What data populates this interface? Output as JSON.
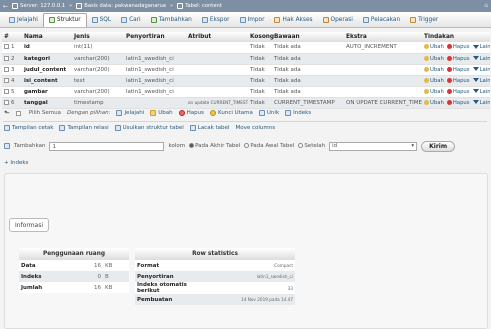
{
  "breadcrumb": {
    "server": "Server: 127.0.0.1",
    "database": "Basis data: pakwanadaganarua",
    "table": "Tabel: content"
  },
  "tabs": [
    {
      "label": "Jelajahi",
      "active": false
    },
    {
      "label": "Struktur",
      "active": true
    },
    {
      "label": "SQL",
      "active": false
    },
    {
      "label": "Cari",
      "active": false
    },
    {
      "label": "Tambahkan",
      "active": false
    },
    {
      "label": "Ekspor",
      "active": false
    },
    {
      "label": "Impor",
      "active": false
    },
    {
      "label": "Hak Akses",
      "active": false
    },
    {
      "label": "Operasi",
      "active": false
    },
    {
      "label": "Pelacakan",
      "active": false
    },
    {
      "label": "Trigger",
      "active": false
    }
  ],
  "columns_table": {
    "headers": [
      "#",
      "Nama",
      "Jenis",
      "Penyortiran",
      "Atribut",
      "Kosong",
      "Bawaan",
      "Ekstra",
      "Tindakan"
    ],
    "rows": [
      {
        "num": "1",
        "name": "id",
        "type": "int(11)",
        "collation": "",
        "attr": "",
        "null": "Tidak",
        "default": "Tidak ada",
        "extra": "AUTO_INCREMENT"
      },
      {
        "num": "2",
        "name": "kategori",
        "type": "varchar(200)",
        "collation": "latin1_swedish_ci",
        "attr": "",
        "null": "Tidak",
        "default": "Tidak ada",
        "extra": ""
      },
      {
        "num": "3",
        "name": "judul_content",
        "type": "varchar(200)",
        "collation": "latin1_swedish_ci",
        "attr": "",
        "null": "Tidak",
        "default": "Tidak ada",
        "extra": ""
      },
      {
        "num": "4",
        "name": "isi_content",
        "type": "text",
        "collation": "latin1_swedish_ci",
        "attr": "",
        "null": "Tidak",
        "default": "Tidak ada",
        "extra": ""
      },
      {
        "num": "5",
        "name": "gambar",
        "type": "varchar(200)",
        "collation": "latin1_swedish_ci",
        "attr": "",
        "null": "Tidak",
        "default": "Tidak ada",
        "extra": ""
      },
      {
        "num": "6",
        "name": "tanggal",
        "type": "timestamp",
        "collation": "",
        "attr": "on update CURRENT_TIMESTAMP",
        "null": "Tidak",
        "default": "CURRENT_TIMESTAMP",
        "extra": "ON UPDATE CURRENT_TIMESTAMP"
      }
    ],
    "actions": {
      "edit": "Ubah",
      "delete": "Hapus",
      "more": "Lainnya"
    }
  },
  "bulk": {
    "check_all": "Pilih Semua",
    "with_selected": "Dengan pilihan:",
    "actions": [
      "Jelajahi",
      "Ubah",
      "Hapus",
      "Kunci Utama",
      "Unik",
      "Indeks"
    ]
  },
  "links": [
    "Tampilan cetak",
    "Tampilan relasi",
    "Usulkan struktur tabel",
    "Lacak tabel",
    "Move columns"
  ],
  "add_columns": {
    "label": "Tambahkan",
    "count": "1",
    "suffix": "kolom",
    "opt_end": "Pada Akhir Tabel",
    "opt_start": "Pada Awal Tabel",
    "opt_after": "Setelah",
    "after_value": "id",
    "submit": "Kirim"
  },
  "indexes_link": "+ Indeks",
  "info": {
    "legend": "Informasi",
    "space_usage": {
      "title": "Penggunaan ruang",
      "rows": [
        {
          "label": "Data",
          "value": "16",
          "unit": "KB"
        },
        {
          "label": "Indeks",
          "value": "0",
          "unit": "B"
        },
        {
          "label": "Jumlah",
          "value": "16",
          "unit": "KB"
        }
      ]
    },
    "row_stats": {
      "title": "Row statistics",
      "rows": [
        {
          "label": "Format",
          "value": "Compact"
        },
        {
          "label": "Penyortiran",
          "value": "latin1_swedish_ci"
        },
        {
          "label": "Indeks otomatis berikut",
          "value": "33"
        },
        {
          "label": "Pembuatan",
          "value": "14 Nov 2019 pada 14.47"
        }
      ]
    }
  },
  "colors": {
    "topbar": "#7d8fa3",
    "link": "#235a81",
    "row_alt": "#e8ebee",
    "delete": "#dd3333"
  }
}
